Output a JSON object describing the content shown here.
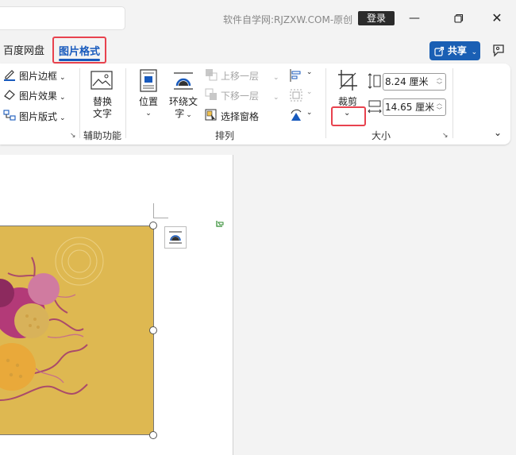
{
  "titlebar": {
    "site_label": "软件自学网:RJZXW.COM-原创",
    "login_label": "登录"
  },
  "tabs": {
    "baidu": "百度网盘",
    "picture_format": "图片格式",
    "share": "共享"
  },
  "ribbon": {
    "styles": {
      "border": "图片边框",
      "effects": "图片效果",
      "layout": "图片版式"
    },
    "accessibility": {
      "alt_text_line1": "替换",
      "alt_text_line2": "文字",
      "group_label": "辅助功能"
    },
    "arrange": {
      "position": "位置",
      "wrap_line1": "环绕文",
      "wrap_line2": "字",
      "bring_forward": "上移一层",
      "send_backward": "下移一层",
      "selection_pane": "选择窗格",
      "group_label": "排列"
    },
    "size": {
      "crop": "裁剪",
      "height": "8.24 厘米",
      "width": "14.65 厘米",
      "group_label": "大小"
    }
  },
  "colors": {
    "accent": "#185abd",
    "highlight": "#e8424e",
    "picture_bg": "#deb851"
  }
}
